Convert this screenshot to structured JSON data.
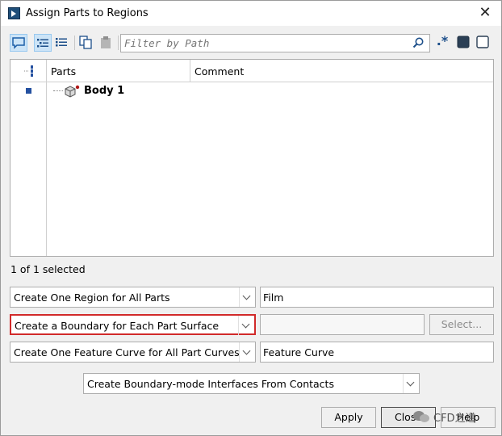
{
  "window": {
    "title": "Assign Parts to Regions"
  },
  "toolbar": {
    "filter_placeholder": "Filter by Path",
    "wildcard_glyph": ".*"
  },
  "tree": {
    "columns": [
      "Parts",
      "Comment"
    ],
    "rows": [
      {
        "name": "Body 1",
        "comment": ""
      }
    ]
  },
  "status": {
    "selection": "1 of 1 selected"
  },
  "options": {
    "region_mode": "Create One Region for All Parts",
    "region_name": "Film",
    "boundary_mode": "Create a Boundary for Each Part Surface",
    "boundary_name": "",
    "select_label": "Select...",
    "feature_mode": "Create One Feature Curve for All Part Curves",
    "feature_name": "Feature Curve",
    "interface_mode": "Create Boundary-mode Interfaces From Contacts"
  },
  "buttons": {
    "apply": "Apply",
    "close": "Close",
    "help": "Help"
  },
  "watermark": {
    "text": "CFD之道"
  },
  "colors": {
    "highlight": "#d12a2a",
    "accent": "#2450a0"
  }
}
